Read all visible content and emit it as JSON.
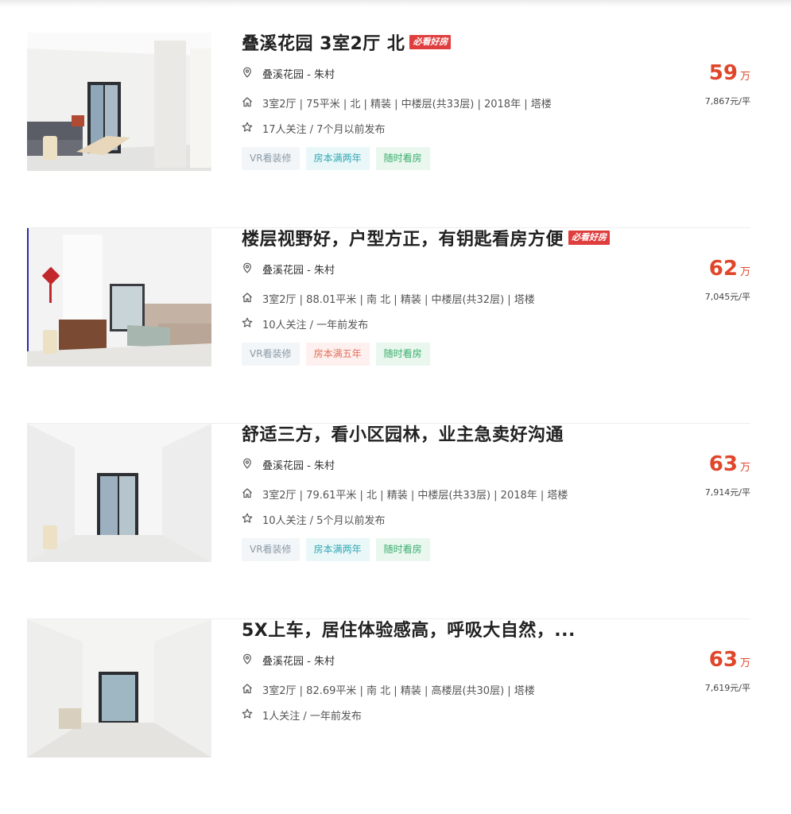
{
  "listings": [
    {
      "title": "叠溪花园 3室2厅 北",
      "must_tag": "必看好房",
      "community": "叠溪花园 - 朱村",
      "details": "3室2厅 | 75平米 | 北 | 精装 | 中楼层(共33层) | 2018年 | 塔楼",
      "follow": "17人关注 / 7个月以前发布",
      "tags": [
        "VR看装修",
        "房本满两年",
        "随时看房"
      ],
      "tag_kinds": [
        "vr",
        "two",
        "see"
      ],
      "total": "59",
      "total_unit": "万",
      "unit_price": "7,867元/平"
    },
    {
      "title": "楼层视野好，户型方正，有钥匙看房方便",
      "must_tag": "必看好房",
      "community": "叠溪花园 - 朱村",
      "details": "3室2厅 | 88.01平米 | 南 北 | 精装 | 中楼层(共32层) | 塔楼",
      "follow": "10人关注 / 一年前发布",
      "tags": [
        "VR看装修",
        "房本满五年",
        "随时看房"
      ],
      "tag_kinds": [
        "vr",
        "five",
        "see"
      ],
      "total": "62",
      "total_unit": "万",
      "unit_price": "7,045元/平"
    },
    {
      "title": "舒适三方，看小区园林，业主急卖好沟通",
      "must_tag": "",
      "community": "叠溪花园 - 朱村",
      "details": "3室2厅 | 79.61平米 | 北 | 精装 | 中楼层(共33层) | 2018年 | 塔楼",
      "follow": "10人关注 / 5个月以前发布",
      "tags": [
        "VR看装修",
        "房本满两年",
        "随时看房"
      ],
      "tag_kinds": [
        "vr",
        "two",
        "see"
      ],
      "total": "63",
      "total_unit": "万",
      "unit_price": "7,914元/平"
    },
    {
      "title": "5X上车，居住体验感高，呼吸大自然，...",
      "must_tag": "",
      "community": "叠溪花园 - 朱村",
      "details": "3室2厅 | 82.69平米 | 南 北 | 精装 | 高楼层(共30层) | 塔楼",
      "follow": "1人关注 / 一年前发布",
      "tags": [],
      "tag_kinds": [],
      "total": "63",
      "total_unit": "万",
      "unit_price": "7,619元/平"
    }
  ],
  "icons": {
    "location": "location-pin-icon",
    "house": "house-icon",
    "star": "star-icon"
  },
  "colors": {
    "price": "#e0462a",
    "must_tag": "#e03e3e"
  }
}
